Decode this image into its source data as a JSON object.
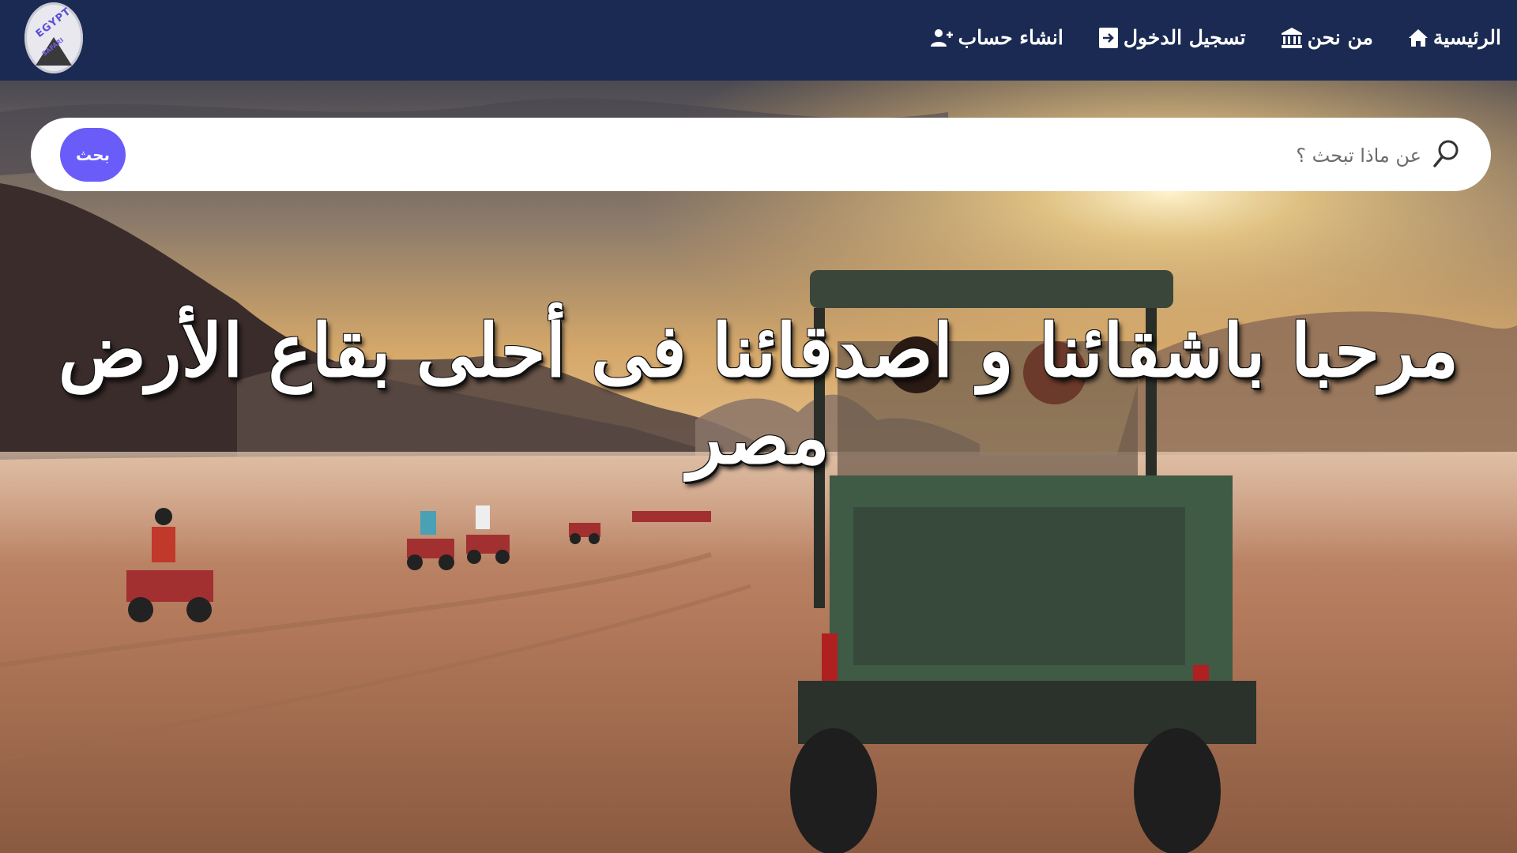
{
  "logo": {
    "main_text": "EGYPT",
    "sub_text": "SAFARI"
  },
  "nav": {
    "home_label": "الرئيسية",
    "about_label": "من نحن",
    "login_label": "تسجيل الدخول",
    "register_label": "انشاء حساب"
  },
  "search": {
    "placeholder": "عن ماذا تبحث ؟",
    "button_label": "بحث"
  },
  "hero": {
    "headline": "مرحبا باشقائنا و اصدقائنا فى أحلى بقاع الأرض مصر",
    "image_semantic": "desert-safari-buggy-quad-bikes"
  },
  "colors": {
    "navbar_bg": "#1b2a52",
    "search_button": "#6a5cf8",
    "text_on_dark": "#ffffff"
  }
}
